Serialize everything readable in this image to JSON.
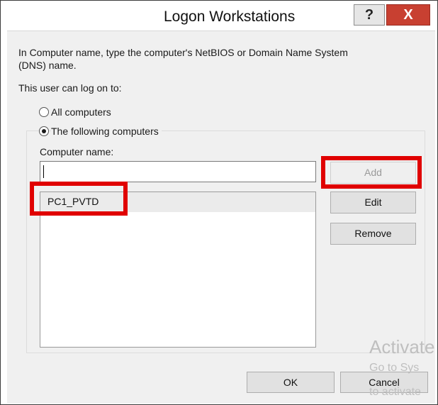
{
  "window": {
    "title": "Logon Workstations",
    "help_label": "?",
    "close_label": "X"
  },
  "instructions": {
    "line1": "In Computer name, type the computer's NetBIOS or Domain Name System",
    "line2": "(DNS) name."
  },
  "logon_section": {
    "label": "This user can log on to:",
    "options": [
      {
        "label": "All computers",
        "selected": false
      },
      {
        "label": "The following computers",
        "selected": true
      }
    ]
  },
  "computer_name": {
    "label": "Computer name:",
    "value": ""
  },
  "computers": [
    {
      "name": "PC1_PVTD"
    }
  ],
  "buttons": {
    "add": "Add",
    "edit": "Edit",
    "remove": "Remove",
    "ok": "OK",
    "cancel": "Cancel"
  },
  "highlight_color": "#e00000",
  "watermark": {
    "line1": "Activate",
    "line2": "Go to Sys",
    "line3": "to activate"
  }
}
